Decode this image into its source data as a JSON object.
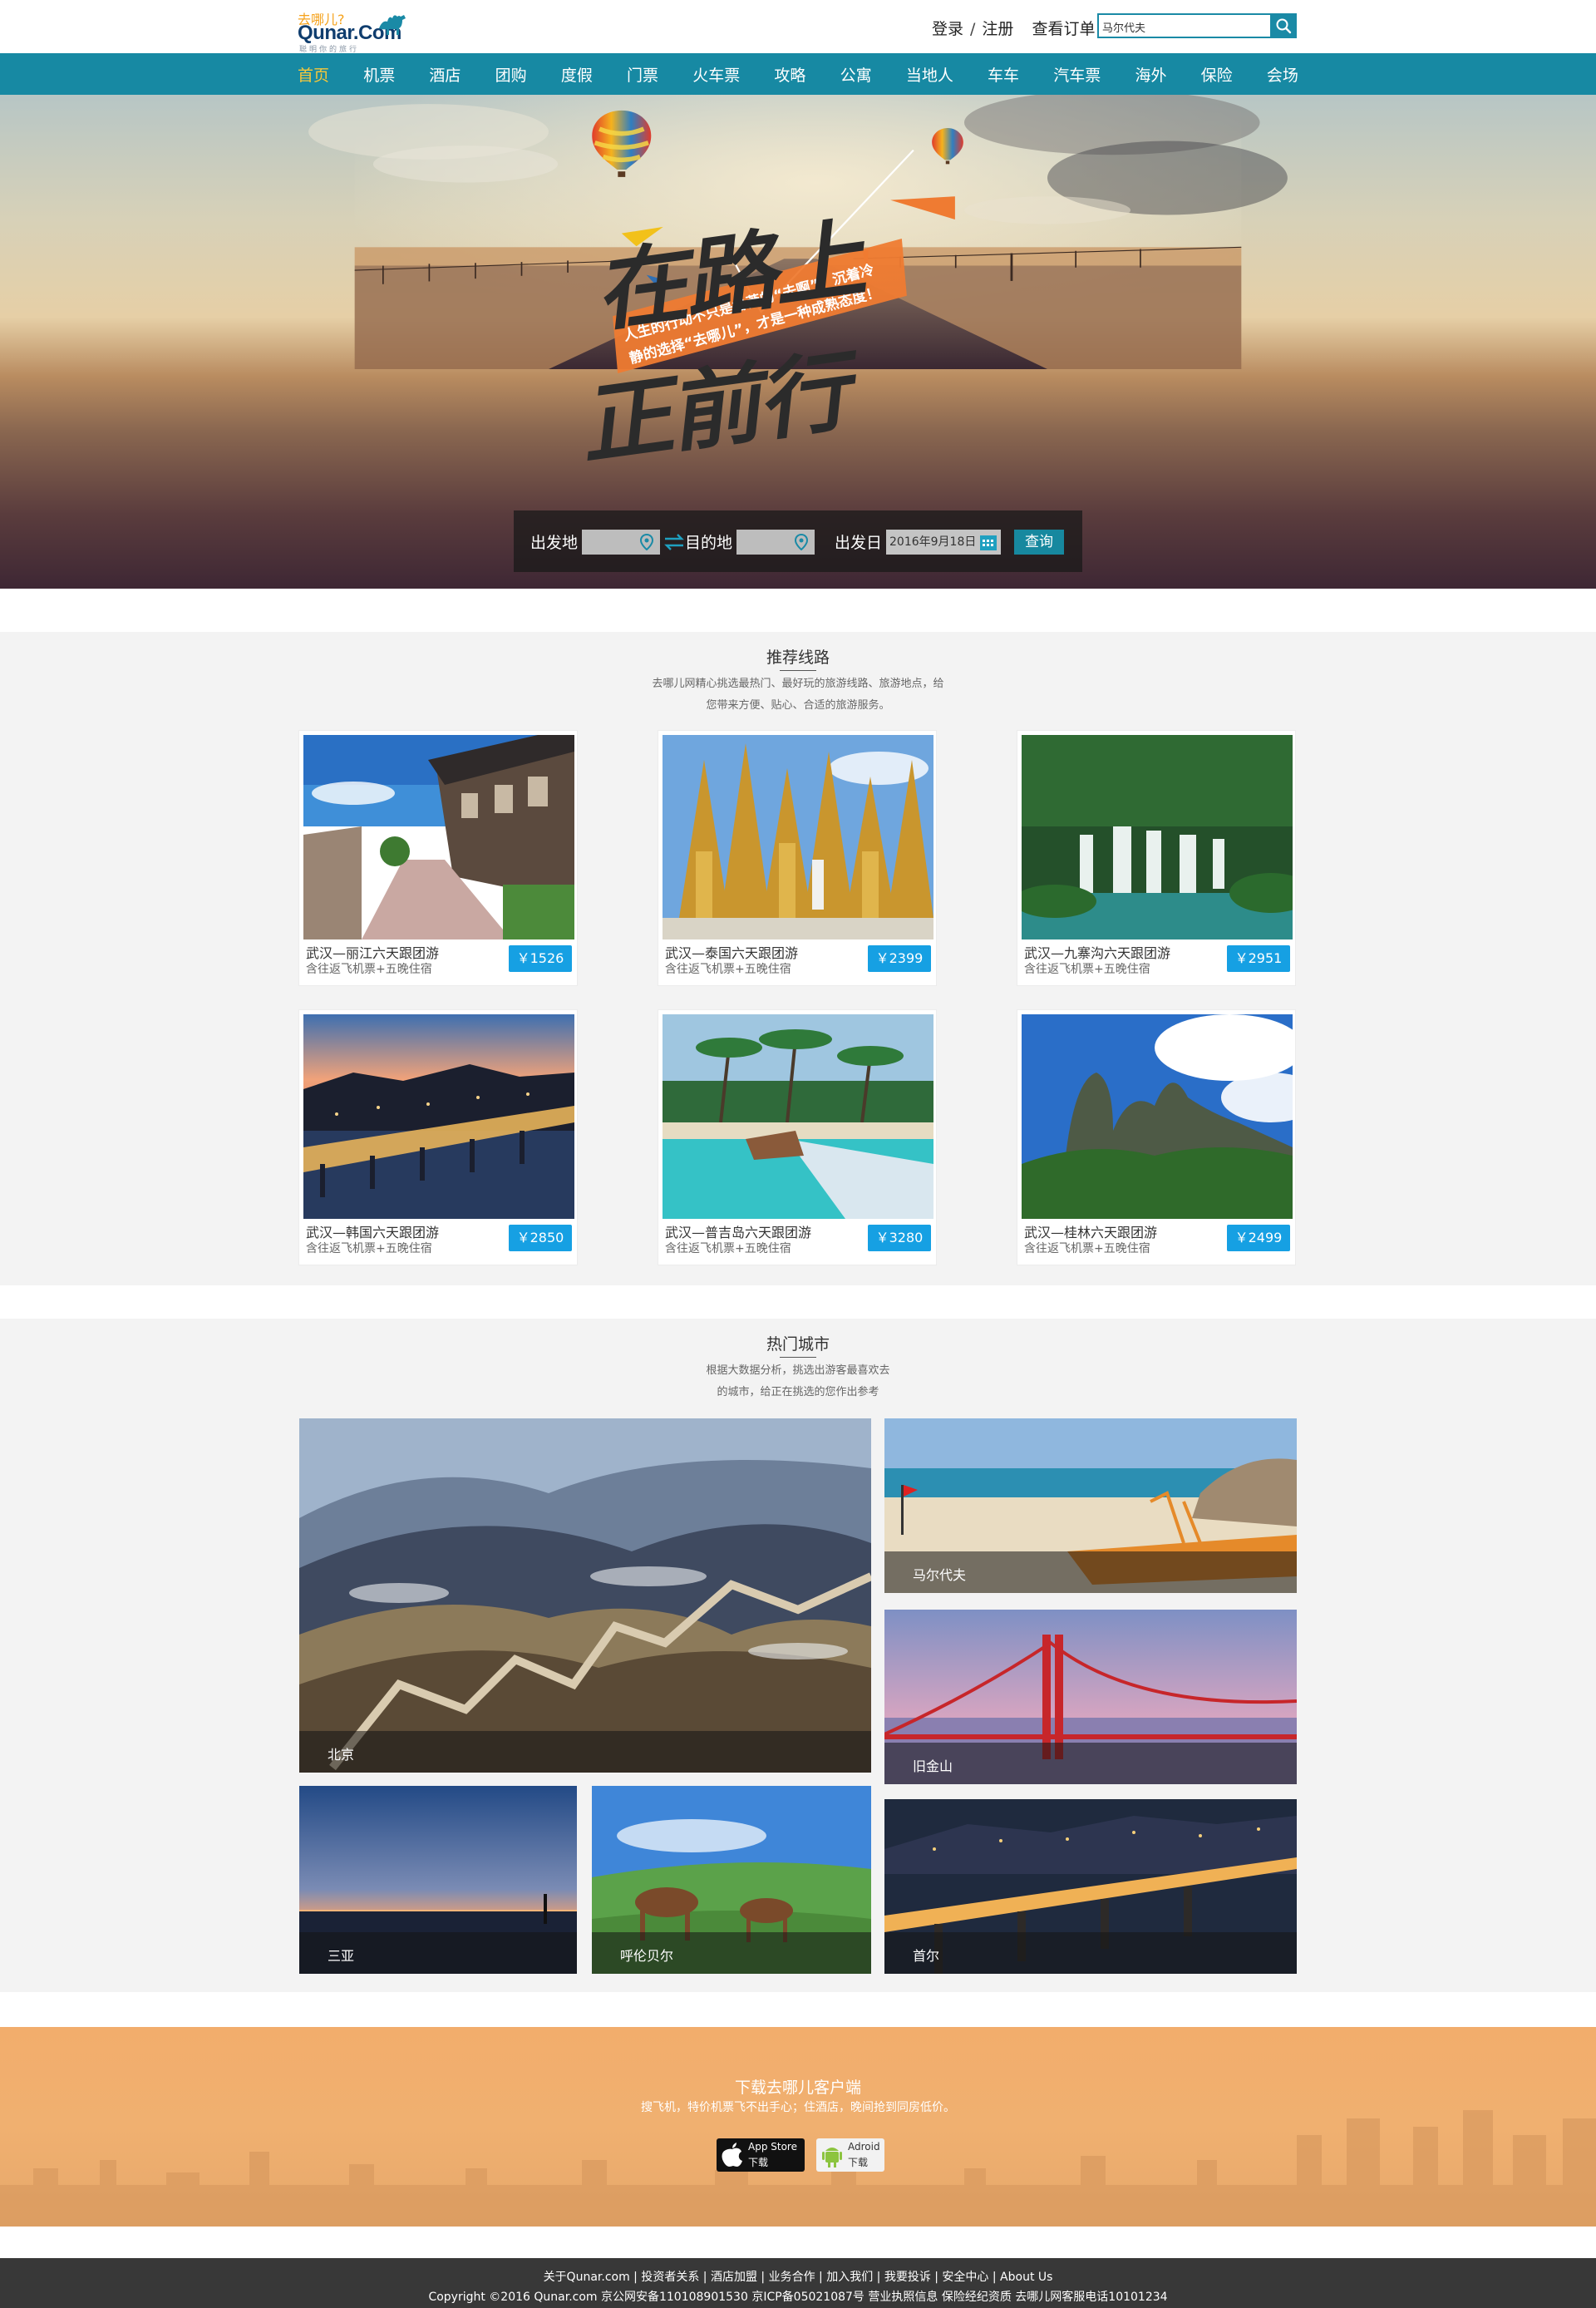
{
  "brand": {
    "sub": "去哪儿?",
    "main": "Qunar.Com",
    "slogan": "聪明你的旅行"
  },
  "header": {
    "login": "登录",
    "sep": "/",
    "register": "注册",
    "orders": "查看订单",
    "search_value": "马尔代夫"
  },
  "nav": [
    "首页",
    "机票",
    "酒店",
    "团购",
    "度假",
    "门票",
    "火车票",
    "攻略",
    "公寓",
    "当地人",
    "车车",
    "汽车票",
    "海外",
    "保险",
    "会场"
  ],
  "hero": {
    "line1": "在路上",
    "line2": "正前行",
    "band_line1": "人生的行动不只是鲁莽的“去啊”，沉着冷",
    "band_line2": "静的选择“去哪儿”，才是一种成熟态度！",
    "from_label": "出发地",
    "to_label": "目的地",
    "date_label": "出发日",
    "date_value": "2016年9月18日",
    "search_btn": "查询"
  },
  "recommend": {
    "title": "推荐线路",
    "desc_line1": "去哪儿网精心挑选最热门、最好玩的旅游线路、旅游地点，给",
    "desc_line2": "您带来方便、贴心、合适的旅游服务。",
    "cards": [
      {
        "name": "武汉—丽江六天跟团游",
        "inc": "含往返飞机票+五晚住宿",
        "price": "￥1526"
      },
      {
        "name": "武汉—泰国六天跟团游",
        "inc": "含往返飞机票+五晚住宿",
        "price": "￥2399"
      },
      {
        "name": "武汉—九寨沟六天跟团游",
        "inc": "含往返飞机票+五晚住宿",
        "price": "￥2951"
      },
      {
        "name": "武汉—韩国六天跟团游",
        "inc": "含往返飞机票+五晚住宿",
        "price": "￥2850"
      },
      {
        "name": "武汉—普吉岛六天跟团游",
        "inc": "含往返飞机票+五晚住宿",
        "price": "￥3280"
      },
      {
        "name": "武汉—桂林六天跟团游",
        "inc": "含往返飞机票+五晚住宿",
        "price": "￥2499"
      }
    ]
  },
  "hot": {
    "title": "热门城市",
    "desc_line1": "根据大数据分析，挑选出游客最喜欢去",
    "desc_line2": "的城市，给正在挑选的您作出参考",
    "cities": [
      "北京",
      "马尔代夫",
      "旧金山",
      "三亚",
      "呼伦贝尔",
      "首尔"
    ]
  },
  "download": {
    "title": "下载去哪儿客户端",
    "desc": "搜飞机，特价机票飞不出手心；住酒店，晚间抢到同房低价。",
    "appstore_t1": "App Store",
    "appstore_t2": "下载",
    "android_t1": "Adroid",
    "android_t2": "下载"
  },
  "footer": {
    "links": "关于Qunar.com | 投资者关系 | 酒店加盟 | 业务合作 | 加入我们 | 我要投诉 | 安全中心 | About Us",
    "copy": "Copyright ©2016 Qunar.com  京公网安备110108901530  京ICP备05021087号  营业执照信息  保险经纪资质  去哪儿网客服电话10101234"
  },
  "colors": {
    "nav_bg": "#1789a3",
    "nav_active": "#f7c83a",
    "price_bg": "#16a0e3",
    "footer_bg": "#383838",
    "download_bg": "#f0b070"
  }
}
